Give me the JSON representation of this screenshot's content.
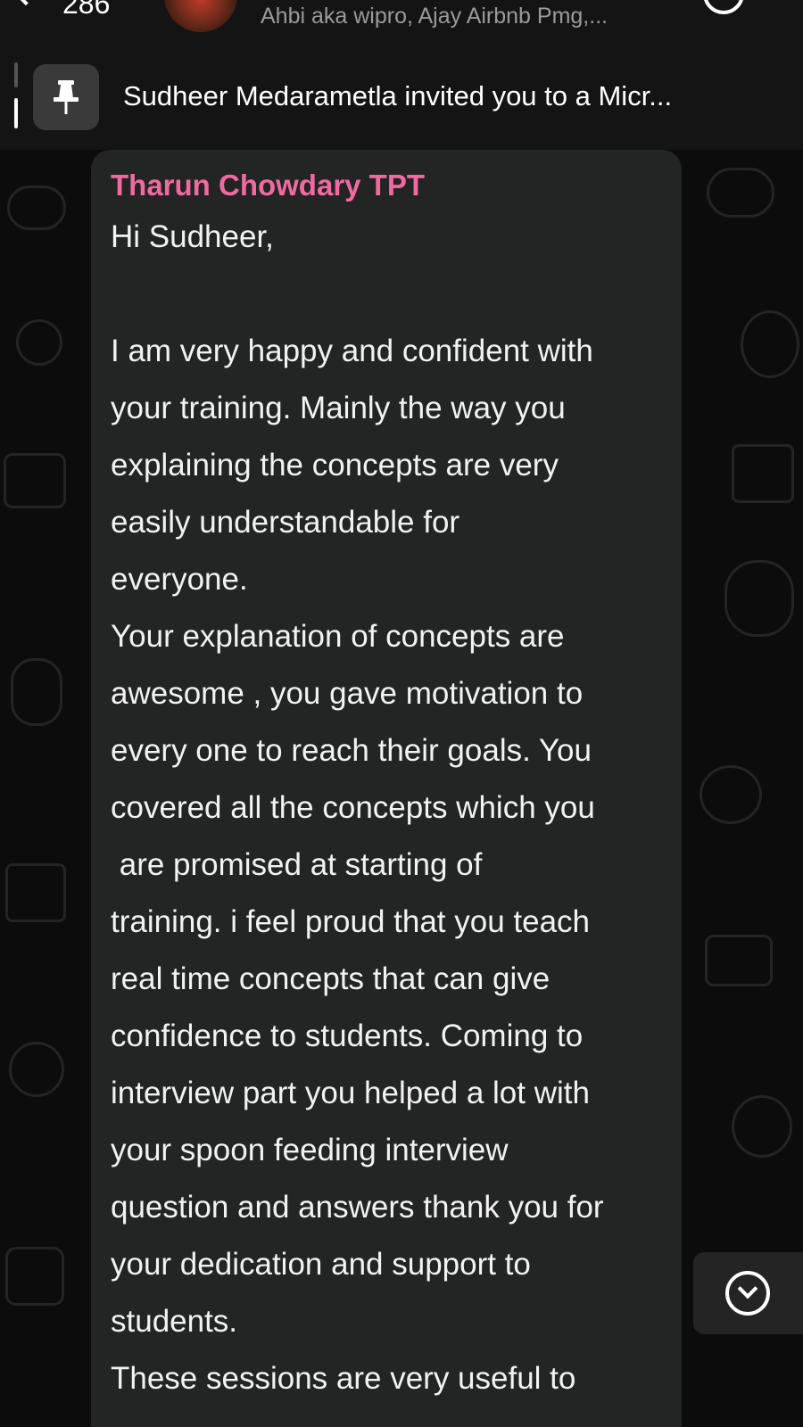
{
  "header": {
    "unread_count": "286",
    "members": "Ahbi aka wipro, Ajay Airbnb Pmg,..."
  },
  "pinned": {
    "text": "Sudheer Medarametla invited you to a Micr..."
  },
  "message": {
    "sender": "Tharun Chowdary TPT",
    "sender_color": "#f06aa0",
    "lines": [
      "Hi Sudheer,",
      "",
      "I am very happy and confident with",
      "your training. Mainly the way you",
      "explaining the concepts are very",
      "easily understandable for",
      "everyone.",
      "Your explanation of concepts are",
      "awesome , you gave motivation to",
      "every one to reach their goals. You",
      "covered all the concepts which you",
      " are promised at starting of",
      "training. i feel proud that you teach",
      "real time concepts that can give",
      "confidence to students. Coming to",
      "interview part you helped a lot with",
      "your spoon feeding interview",
      "question and answers thank you for",
      "your dedication and support to",
      "students.",
      "These sessions are very useful to"
    ]
  },
  "icons": {
    "back": "chevron-left-icon",
    "call": "call-icon",
    "pin": "pin-icon",
    "scroll": "chevron-down-icon"
  }
}
